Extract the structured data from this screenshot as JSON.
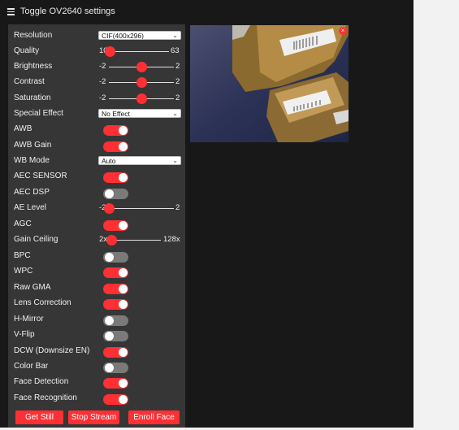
{
  "header": {
    "title": "Toggle OV2640 settings"
  },
  "settings": {
    "resolution": {
      "label": "Resolution",
      "value": "CIF(400x296)"
    },
    "quality": {
      "label": "Quality",
      "min": "10",
      "max": "63",
      "value": 10
    },
    "brightness": {
      "label": "Brightness",
      "min": "-2",
      "max": "2",
      "value": 0
    },
    "contrast": {
      "label": "Contrast",
      "min": "-2",
      "max": "2",
      "value": 0
    },
    "saturation": {
      "label": "Saturation",
      "min": "-2",
      "max": "2",
      "value": 0
    },
    "special_effect": {
      "label": "Special Effect",
      "value": "No Effect"
    },
    "awb": {
      "label": "AWB",
      "on": true
    },
    "awb_gain": {
      "label": "AWB Gain",
      "on": true
    },
    "wb_mode": {
      "label": "WB Mode",
      "value": "Auto"
    },
    "aec_sensor": {
      "label": "AEC SENSOR",
      "on": true
    },
    "aec_dsp": {
      "label": "AEC DSP",
      "on": false
    },
    "ae_level": {
      "label": "AE Level",
      "min": "-2",
      "max": "2",
      "value": -2
    },
    "agc": {
      "label": "AGC",
      "on": true
    },
    "gain_ceiling": {
      "label": "Gain Ceiling",
      "min": "2x",
      "max": "128x",
      "value": 0
    },
    "bpc": {
      "label": "BPC",
      "on": false
    },
    "wpc": {
      "label": "WPC",
      "on": true
    },
    "raw_gma": {
      "label": "Raw GMA",
      "on": true
    },
    "lens_correction": {
      "label": "Lens Correction",
      "on": true
    },
    "h_mirror": {
      "label": "H-Mirror",
      "on": false
    },
    "v_flip": {
      "label": "V-Flip",
      "on": false
    },
    "dcw": {
      "label": "DCW (Downsize EN)",
      "on": true
    },
    "color_bar": {
      "label": "Color Bar",
      "on": false
    },
    "face_detection": {
      "label": "Face Detection",
      "on": true
    },
    "face_recognition": {
      "label": "Face Recognition",
      "on": true
    }
  },
  "buttons": {
    "get_still": "Get Still",
    "stop_stream": "Stop Stream",
    "enroll_face": "Enroll Face"
  },
  "icons": {
    "menu": "hamburger-menu-icon",
    "close": "close-icon",
    "select_arrow": "chevron-down-icon"
  },
  "colors": {
    "accent": "#ff3034",
    "panel": "#363636",
    "background": "#181818",
    "toggle_off": "#7a7a7a"
  }
}
